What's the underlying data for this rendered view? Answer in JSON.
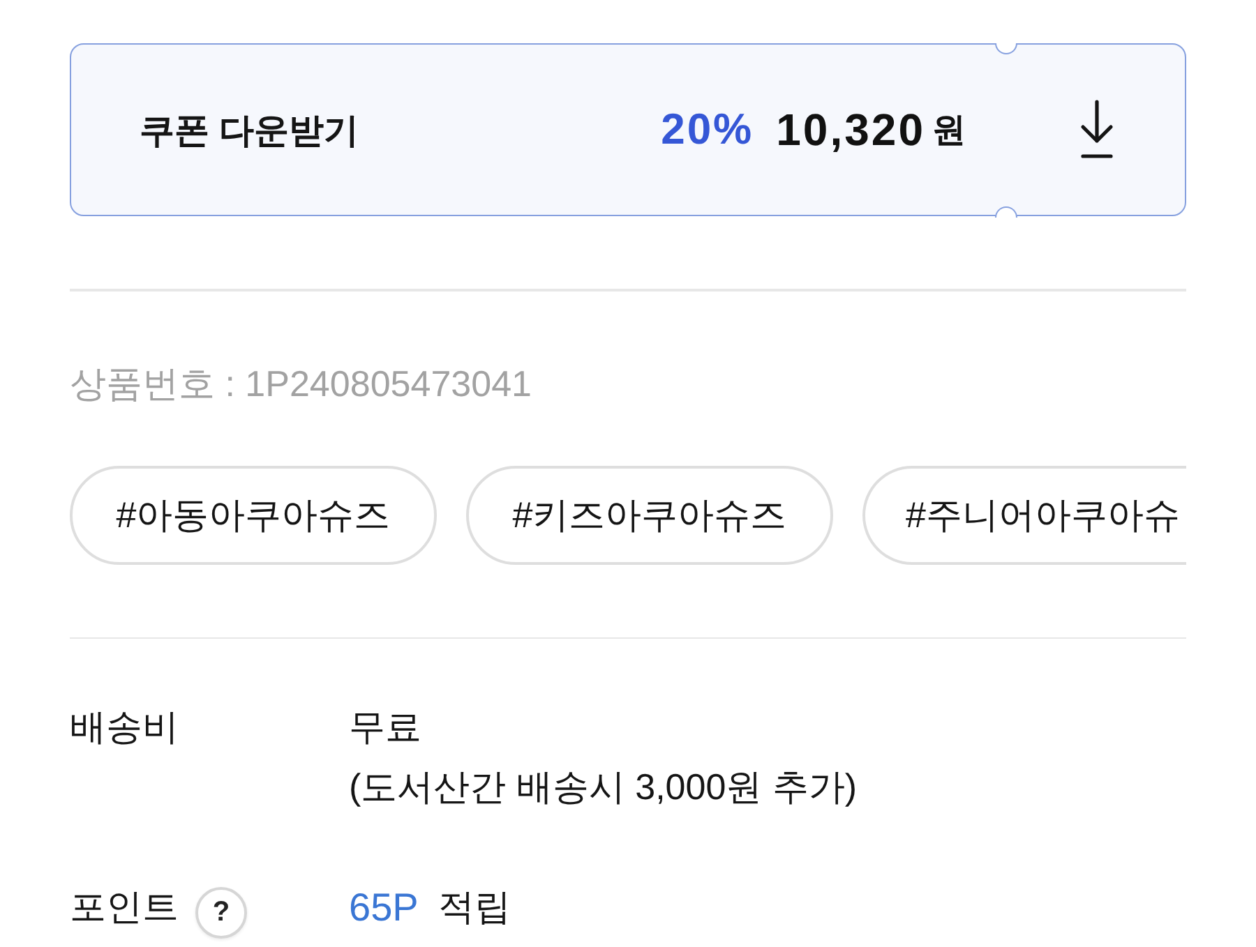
{
  "coupon": {
    "label": "쿠폰 다운받기",
    "discount": "20%",
    "price": "10,320",
    "currency": "원"
  },
  "product_number": "상품번호 : 1P240805473041",
  "tags": [
    "#아동아쿠아슈즈",
    "#키즈아쿠아슈즈",
    "#주니어아쿠아슈"
  ],
  "info_rows": [
    {
      "kind": "lines",
      "label": "배송비",
      "lines": [
        "무료",
        "(도서산간 배송시 3,000원 추가)"
      ]
    },
    {
      "kind": "points",
      "label": "포인트",
      "help": "?",
      "amount": "65P",
      "suffix": "적립"
    }
  ]
}
